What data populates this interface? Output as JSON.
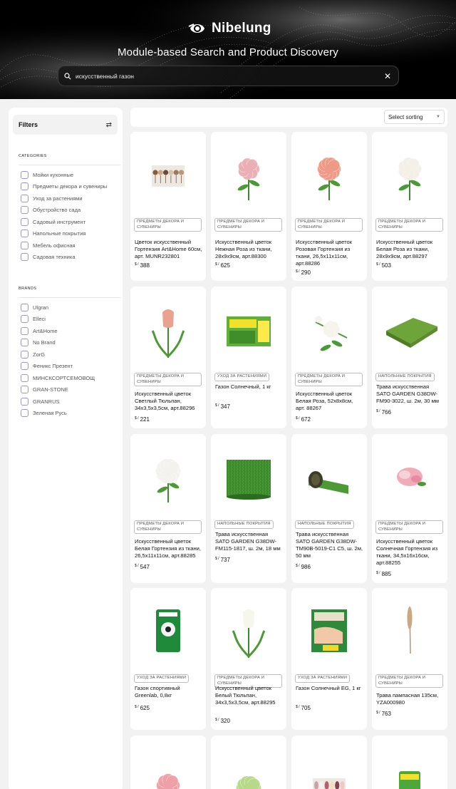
{
  "header": {
    "brand": "Nibelung",
    "subtitle": "Module-based Search and Product Discovery",
    "search_value": "искусственный газон",
    "search_placeholder": "",
    "colors": {
      "background": "#000000",
      "text": "#ffffff"
    }
  },
  "sidebar": {
    "title": "Filters",
    "categories_heading": "CATEGORIES",
    "categories": [
      "Мойки кухонные",
      "Предметы декора и сувениры",
      "Уход за растениями",
      "Обустройство сада",
      "Садовый инструмент",
      "Напольные покрытия",
      "Мебель офисная",
      "Садовая техника"
    ],
    "brands_heading": "BRANDS",
    "brands": [
      "Ulgran",
      "Elleci",
      "Art&Home",
      "No Brand",
      "ZorG",
      "Феникс Презент",
      "МИНСКСОРТСЕМОВОЩ",
      "GRAN-STONE",
      "GRANRUS",
      "Зеленая Русь"
    ],
    "checkbox_color": "#9a96d2"
  },
  "sort": {
    "label": "Select sorting"
  },
  "currency": "$ /",
  "products": [
    {
      "badge": "ПРЕДМЕТЫ ДЕКОРА И СУВЕНИРЫ",
      "title": "Цветок искусственный Гортензия Art&Home 60см, арт. MUNR232801",
      "price": "388",
      "image": "decor-balls-icon"
    },
    {
      "badge": "ПРЕДМЕТЫ ДЕКОРА И СУВЕНИРЫ",
      "title": "Искусственный цветок Нежная Роза из ткани, 28х9х9см, арт.88300",
      "price": "625",
      "image": "pink-rose-icon"
    },
    {
      "badge": "ПРЕДМЕТЫ ДЕКОРА И СУВЕНИРЫ",
      "title": "Искусственный цветок Розовая Гортензия из ткани, 26,5х11х11см, арт.88286",
      "price": "290",
      "image": "pink-hydrangea-icon"
    },
    {
      "badge": "ПРЕДМЕТЫ ДЕКОРА И СУВЕНИРЫ",
      "title": "Искусственный цветок Белая Роза из ткани, 28х9х9см, арт.88297",
      "price": "503",
      "image": "white-rose-icon"
    },
    {
      "badge": "ПРЕДМЕТЫ ДЕКОРА И СУВЕНИРЫ",
      "title": "Искусственный цветок Светлый Тюльпан, 34х3,5х3,5см, арт.88296",
      "price": "221",
      "image": "pink-tulip-icon"
    },
    {
      "badge": "УХОД ЗА РАСТЕНИЯМИ",
      "title": "Газон Солнечный, 1 кг",
      "price": "347",
      "image": "seed-box-icon"
    },
    {
      "badge": "ПРЕДМЕТЫ ДЕКОРА И СУВЕНИРЫ",
      "title": "Искусственный цветок Белая Роза, 52х8х8см, арт. 88267",
      "price": "672",
      "image": "white-rose-branch-icon"
    },
    {
      "badge": "НАПОЛЬНЫЕ ПОКРЫТИЯ",
      "title": "Трава искусственная SATO GARDEN G38DW-FM90-3022, ш. 2м, 30 мм",
      "price": "766",
      "image": "grass-tile-icon"
    },
    {
      "badge": "ПРЕДМЕТЫ ДЕКОРА И СУВЕНИРЫ",
      "title": "Искусственный цветок Белая Гортензия из ткани, 26,5х11х11см, арт.88285",
      "price": "547",
      "image": "white-hydrangea-icon"
    },
    {
      "badge": "НАПОЛЬНЫЕ ПОКРЫТИЯ",
      "title": "Трава искусственная SATO GARDEN G38DW-FM115-1817, ш. 2м, 18 мм",
      "price": "737",
      "image": "grass-roll-icon"
    },
    {
      "badge": "НАПОЛЬНЫЕ ПОКРЫТИЯ",
      "title": "Трава искусственная SATO GARDEN G38DW-TM90B-5019-C1 C5, ш. 2м, 50 мм",
      "price": "986",
      "image": "grass-roll-small-icon"
    },
    {
      "badge": "ПРЕДМЕТЫ ДЕКОРА И СУВЕНИРЫ",
      "title": "Искусственный цветок Солнечная Гортензия из ткани, 34,5х16х16см, арт.88255",
      "price": "885",
      "image": "sunny-hydrangea-icon"
    },
    {
      "badge": "УХОД ЗА РАСТЕНИЯМИ",
      "title": "Газон спортивный Greenlab, 0,8кг",
      "price": "625",
      "image": "seed-bag-icon"
    },
    {
      "badge": "ПРЕДМЕТЫ ДЕКОРА И СУВЕНИРЫ",
      "title": "Искусственный цветок Белый Тюльпан, 34х3,5х3,5см, арт.88295",
      "price": "320",
      "image": "white-tulip-icon"
    },
    {
      "badge": "УХОД ЗА РАСТЕНИЯМИ",
      "title": "Газон Солнечный EG, 1 кг",
      "price": "705",
      "image": "seed-pack-icon"
    },
    {
      "badge": "ПРЕДМЕТЫ ДЕКОРА И СУВЕНИРЫ",
      "title": "Трава пампасная 135см, YZA000980",
      "price": "763",
      "image": "pampas-icon"
    },
    {
      "badge": "",
      "title": "",
      "price": "",
      "image": "pink-peony-icon"
    },
    {
      "badge": "",
      "title": "",
      "price": "",
      "image": "green-hydrangea-icon"
    },
    {
      "badge": "",
      "title": "",
      "price": "",
      "image": "tulips-bunch-icon"
    },
    {
      "badge": "",
      "title": "",
      "price": "",
      "image": "green-bag-icon"
    }
  ]
}
